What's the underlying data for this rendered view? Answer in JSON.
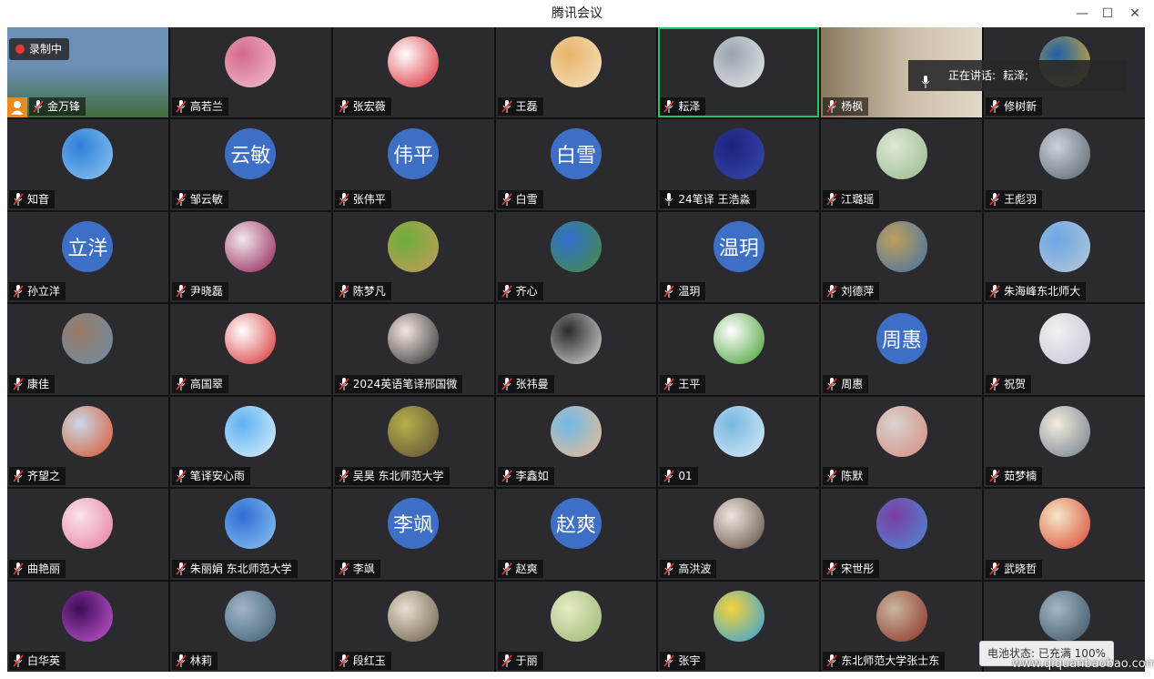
{
  "window": {
    "title": "腾讯会议",
    "minimize": "—",
    "maximize": "☐",
    "close": "✕"
  },
  "recording_label": "录制中",
  "speaking": {
    "label": "正在讲话:",
    "name": "耘泽;"
  },
  "battery_text": "电池状态: 已充满 100%",
  "site_watermark": "www.qiquanbaobao.com",
  "participants": [
    {
      "name": "金万锋",
      "avatar": {
        "type": "photo",
        "colors": [
          "#6b8fb5",
          "#3f6b3a"
        ]
      }
    },
    {
      "name": "高若兰",
      "avatar": {
        "type": "photo",
        "colors": [
          "#d46a8a",
          "#f2c0cf"
        ]
      }
    },
    {
      "name": "张宏薇",
      "avatar": {
        "type": "photo",
        "colors": [
          "#ffffff",
          "#d9232e"
        ]
      }
    },
    {
      "name": "王磊",
      "avatar": {
        "type": "photo",
        "colors": [
          "#e8b469",
          "#f3e2c0"
        ]
      }
    },
    {
      "name": "耘泽",
      "avatar": {
        "type": "photo",
        "colors": [
          "#9aa5ad",
          "#e5e7ea"
        ]
      },
      "active": true
    },
    {
      "name": "杨枫",
      "avatar": {
        "type": "photo",
        "colors": [
          "#8a7760",
          "#cdbfa8"
        ]
      }
    },
    {
      "name": "修树新",
      "avatar": {
        "type": "photo",
        "colors": [
          "#1f5fa8",
          "#e3b12c"
        ]
      }
    },
    {
      "name": "知音",
      "avatar": {
        "type": "photo",
        "colors": [
          "#2d7fd8",
          "#8ec7f2"
        ]
      }
    },
    {
      "name": "邹云敏",
      "avatar": {
        "type": "text",
        "text": "云敏"
      }
    },
    {
      "name": "张伟平",
      "avatar": {
        "type": "text",
        "text": "伟平"
      }
    },
    {
      "name": "白雪",
      "avatar": {
        "type": "text",
        "text": "白雪"
      }
    },
    {
      "name": "24笔译 王浩淼",
      "avatar": {
        "type": "photo",
        "colors": [
          "#1a237e",
          "#3949ab"
        ]
      },
      "muted": false
    },
    {
      "name": "江璐瑶",
      "avatar": {
        "type": "photo",
        "colors": [
          "#dfe8d5",
          "#96b98a"
        ]
      }
    },
    {
      "name": "王彪羽",
      "avatar": {
        "type": "photo",
        "colors": [
          "#cdd3d8",
          "#54616b"
        ]
      }
    },
    {
      "name": "孙立洋",
      "avatar": {
        "type": "text",
        "text": "立洋"
      }
    },
    {
      "name": "尹晓磊",
      "avatar": {
        "type": "photo",
        "colors": [
          "#f2e6ee",
          "#8e1d4f"
        ]
      }
    },
    {
      "name": "陈梦凡",
      "avatar": {
        "type": "photo",
        "colors": [
          "#6cae3b",
          "#c89a5b"
        ]
      }
    },
    {
      "name": "齐心",
      "avatar": {
        "type": "photo",
        "colors": [
          "#2f6fd0",
          "#4a8c3a"
        ]
      }
    },
    {
      "name": "温玥",
      "avatar": {
        "type": "text",
        "text": "温玥"
      }
    },
    {
      "name": "刘德萍",
      "avatar": {
        "type": "photo",
        "colors": [
          "#c0a05a",
          "#3e6fa8"
        ]
      }
    },
    {
      "name": "朱海峰东北师大",
      "avatar": {
        "type": "photo",
        "colors": [
          "#6aa6e6",
          "#b9c9d6"
        ]
      }
    },
    {
      "name": "康佳",
      "avatar": {
        "type": "photo",
        "colors": [
          "#9b7b66",
          "#6b8da6"
        ]
      }
    },
    {
      "name": "高国翠",
      "avatar": {
        "type": "photo",
        "colors": [
          "#ffffff",
          "#d42b2b"
        ]
      }
    },
    {
      "name": "2024英语笔译邢国微",
      "avatar": {
        "type": "photo",
        "colors": [
          "#f3e6e1",
          "#2b2b2b"
        ]
      }
    },
    {
      "name": "张祎曼",
      "avatar": {
        "type": "photo",
        "colors": [
          "#2b2b2b",
          "#d9d9d9"
        ]
      }
    },
    {
      "name": "王平",
      "avatar": {
        "type": "photo",
        "colors": [
          "#ffffff",
          "#3f9b2b"
        ]
      }
    },
    {
      "name": "周惠",
      "avatar": {
        "type": "text",
        "text": "周惠"
      }
    },
    {
      "name": "祝贺",
      "avatar": {
        "type": "photo",
        "colors": [
          "#f1f1f1",
          "#c9c2d6"
        ]
      }
    },
    {
      "name": "齐望之",
      "avatar": {
        "type": "photo",
        "colors": [
          "#c9d9e6",
          "#d8532c"
        ]
      }
    },
    {
      "name": "笔译安心雨",
      "avatar": {
        "type": "photo",
        "colors": [
          "#5db2f0",
          "#dff1fb"
        ]
      }
    },
    {
      "name": "吴昊 东北师范大学",
      "avatar": {
        "type": "photo",
        "colors": [
          "#b7b04a",
          "#5c4d38"
        ]
      }
    },
    {
      "name": "李鑫如",
      "avatar": {
        "type": "photo",
        "colors": [
          "#6fbbe8",
          "#f0b98e"
        ]
      }
    },
    {
      "name": "01",
      "avatar": {
        "type": "photo",
        "colors": [
          "#7ab7e0",
          "#d6ecf7"
        ]
      }
    },
    {
      "name": "陈默",
      "avatar": {
        "type": "photo",
        "colors": [
          "#d8d3cf",
          "#d88a7d"
        ]
      }
    },
    {
      "name": "茹梦楠",
      "avatar": {
        "type": "photo",
        "colors": [
          "#f4ecde",
          "#6e7b8a"
        ]
      }
    },
    {
      "name": "曲艳丽",
      "avatar": {
        "type": "photo",
        "colors": [
          "#fbe3ec",
          "#e67aa3"
        ]
      }
    },
    {
      "name": "朱丽娟 东北师范大学",
      "avatar": {
        "type": "photo",
        "colors": [
          "#2f6dd6",
          "#8cc6f2"
        ]
      }
    },
    {
      "name": "李飒",
      "avatar": {
        "type": "text",
        "text": "李飒"
      }
    },
    {
      "name": "赵爽",
      "avatar": {
        "type": "text",
        "text": "赵爽"
      }
    },
    {
      "name": "高洪波",
      "avatar": {
        "type": "photo",
        "colors": [
          "#eee7df",
          "#5c4a3f"
        ]
      }
    },
    {
      "name": "宋世彤",
      "avatar": {
        "type": "photo",
        "colors": [
          "#7a3fa0",
          "#4c8ad6"
        ]
      }
    },
    {
      "name": "武晓哲",
      "avatar": {
        "type": "photo",
        "colors": [
          "#f6e7c8",
          "#d9442f"
        ]
      }
    },
    {
      "name": "白华英",
      "avatar": {
        "type": "photo",
        "colors": [
          "#3b0b55",
          "#c75ad6"
        ]
      }
    },
    {
      "name": "林莉",
      "avatar": {
        "type": "photo",
        "colors": [
          "#9fb6c9",
          "#3e5d6f"
        ]
      }
    },
    {
      "name": "段红玉",
      "avatar": {
        "type": "photo",
        "colors": [
          "#e8e0d0",
          "#6b5a46"
        ]
      }
    },
    {
      "name": "于丽",
      "avatar": {
        "type": "photo",
        "colors": [
          "#e5ecc3",
          "#9ab574"
        ]
      }
    },
    {
      "name": "张宇",
      "avatar": {
        "type": "photo",
        "colors": [
          "#f6d33c",
          "#2aa0e0"
        ]
      }
    },
    {
      "name": "东北师范大学张士东",
      "avatar": {
        "type": "photo",
        "colors": [
          "#c9b7a0",
          "#8b2d22"
        ]
      }
    },
    {
      "name": "",
      "avatar": {
        "type": "photo",
        "colors": [
          "#9fb8c9",
          "#3b4e5b"
        ]
      }
    }
  ]
}
